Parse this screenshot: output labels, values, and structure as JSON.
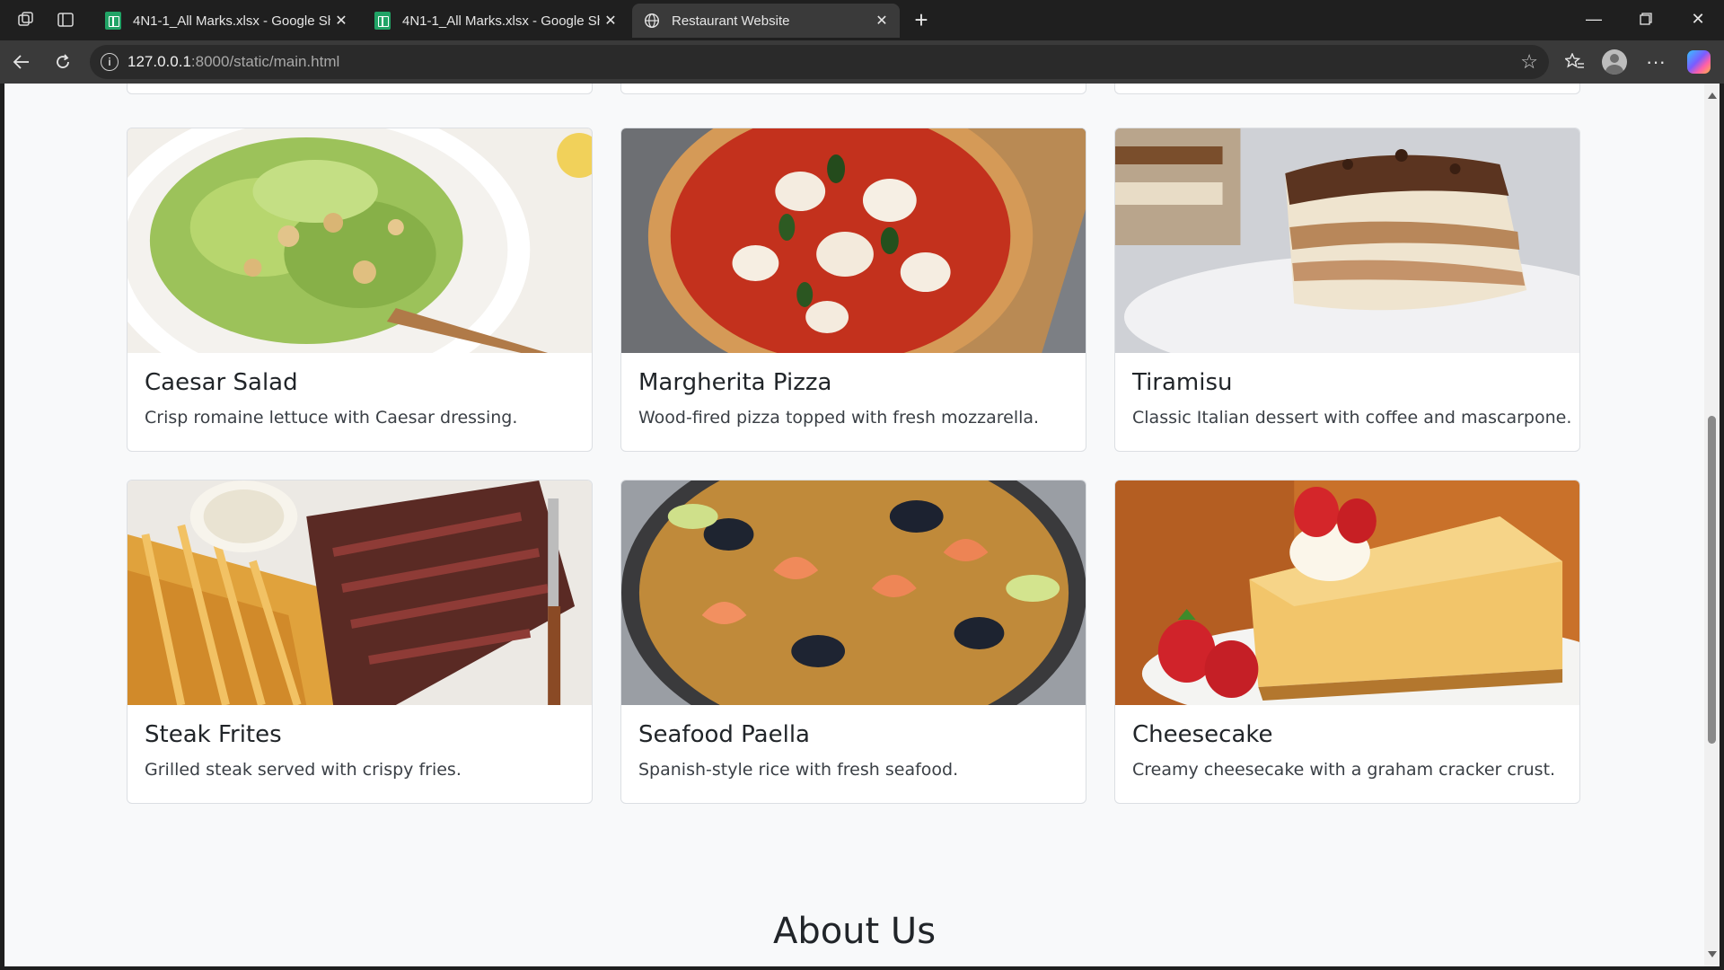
{
  "browser": {
    "tabs": [
      {
        "title": "4N1-1_All Marks.xlsx - Google Sh",
        "favicon": "google-sheets-icon",
        "active": false
      },
      {
        "title": "4N1-1_All Marks.xlsx - Google Sh",
        "favicon": "google-sheets-icon",
        "active": false
      },
      {
        "title": "Restaurant Website",
        "favicon": "globe-icon",
        "active": true
      }
    ],
    "url_host": "127.0.0.1",
    "url_path": ":8000/static/main.html"
  },
  "menu": {
    "items": [
      {
        "name": "Caesar Salad",
        "description": "Crisp romaine lettuce with Caesar dressing."
      },
      {
        "name": "Margherita Pizza",
        "description": "Wood-fired pizza topped with fresh mozzarella."
      },
      {
        "name": "Tiramisu",
        "description": "Classic Italian dessert with coffee and mascarpone."
      },
      {
        "name": "Steak Frites",
        "description": "Grilled steak served with crispy fries."
      },
      {
        "name": "Seafood Paella",
        "description": "Spanish-style rice with fresh seafood."
      },
      {
        "name": "Cheesecake",
        "description": "Creamy cheesecake with a graham cracker crust."
      }
    ]
  },
  "about": {
    "heading": "About Us"
  },
  "colors": {
    "page_bg": "#f8f9fa",
    "browser_chrome": "#1f1f1f",
    "toolbar": "#3a3a3a"
  }
}
